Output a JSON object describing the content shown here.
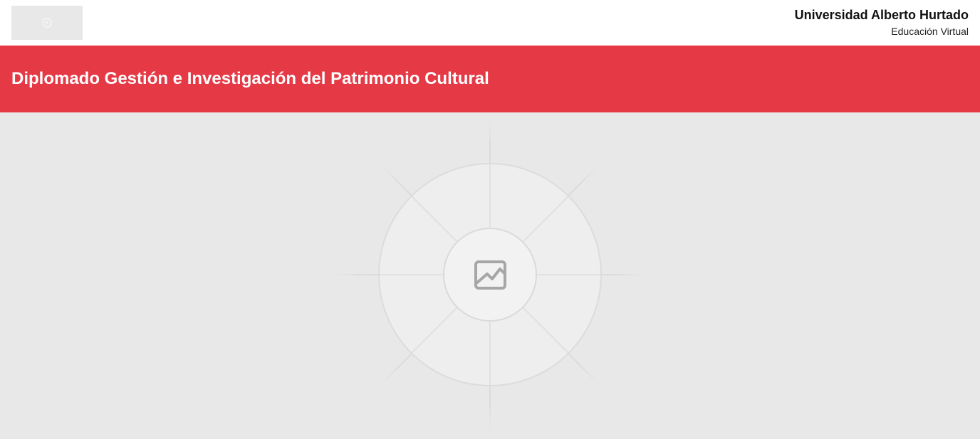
{
  "header": {
    "logo_icon": "spinner-icon",
    "institution_name": "Universidad Alberto Hurtado",
    "department": "Educación Virtual"
  },
  "banner": {
    "course_title": "Diplomado Gestión e Investigación del Patrimonio Cultural",
    "color": "#e63946"
  },
  "hero": {
    "placeholder_icon": "image-placeholder-icon"
  }
}
